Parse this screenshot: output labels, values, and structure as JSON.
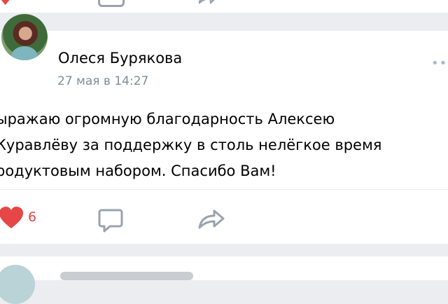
{
  "previous_post": {
    "heart_icon": "heart-icon",
    "comment_icon": "comment-icon",
    "share_icon": "share-icon"
  },
  "post": {
    "author": "Олеся Бурякова",
    "date": "27 мая в 14:27",
    "more_icon": "more-dots-icon",
    "text": "ыражаю огромную благодарность Алексею\nКуравлёву за поддержку в столь нелёгкое время\nродуктовым набором. Спасибо Вам!",
    "actions": {
      "like_icon": "heart-icon",
      "like_count": "6",
      "comment_icon": "comment-icon",
      "share_icon": "share-icon"
    }
  },
  "colors": {
    "like_red": "#e64646",
    "icon_gray": "#99a2ad",
    "date_gray": "#818c99",
    "background": "#ebedf0"
  }
}
